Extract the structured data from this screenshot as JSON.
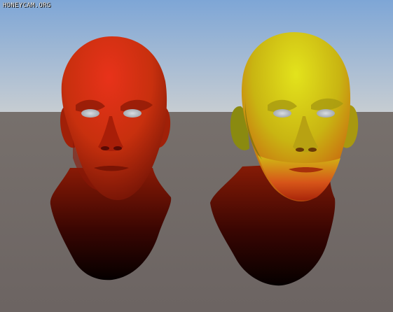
{
  "watermark": "HONEYCAM.ORG",
  "scene": {
    "skybox": {
      "sky_top": "#7ea6d6",
      "sky_horizon": "#c7cdd2",
      "ground": "#6c6462",
      "ground_far": "#77706c"
    },
    "models": [
      {
        "name": "head-red",
        "highlight": "#e8321a",
        "mid": "#c8300e",
        "shadow": "#5a0a04"
      },
      {
        "name": "head-yellow",
        "highlight": "#e3e31c",
        "mid": "#c9b512",
        "shadow": "#5e0c04"
      }
    ]
  }
}
